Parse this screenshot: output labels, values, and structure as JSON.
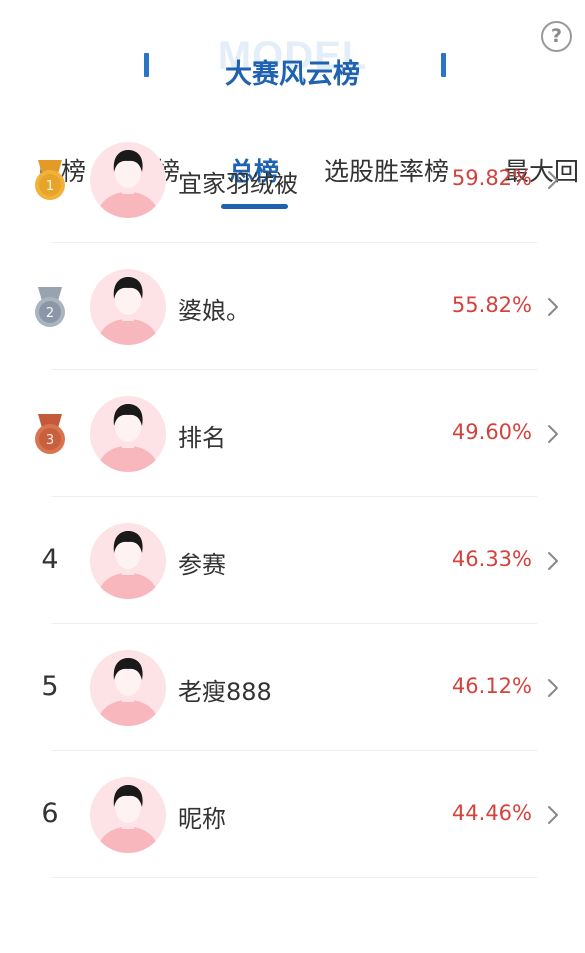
{
  "header": {
    "watermark": "MODEL",
    "title": "大赛风云榜",
    "help_icon": "question-circle-icon",
    "help_symbol": "?"
  },
  "tabs": [
    {
      "label": "日榜",
      "active": false
    },
    {
      "label": "周榜",
      "active": false
    },
    {
      "label": "总榜",
      "active": true
    },
    {
      "label": "选股胜率榜",
      "active": false
    },
    {
      "label": "最大回",
      "active": false
    }
  ],
  "colors": {
    "accent": "#1e62b0",
    "percent": "#d4423c",
    "gold": "#e7a42a",
    "silver": "#8b97a6",
    "bronze": "#c7603f",
    "avatar_bg": "#fde3e5"
  },
  "ranking": [
    {
      "rank": "1",
      "medal": "gold",
      "name": "宜家羽绒被",
      "value": "59.82%"
    },
    {
      "rank": "2",
      "medal": "silver",
      "name": "婆娘。",
      "value": "55.82%"
    },
    {
      "rank": "3",
      "medal": "bronze",
      "name": "排名",
      "value": "49.60%"
    },
    {
      "rank": "4",
      "medal": null,
      "name": "参赛",
      "value": "46.33%"
    },
    {
      "rank": "5",
      "medal": null,
      "name": "老瘦888",
      "value": "46.12%"
    },
    {
      "rank": "6",
      "medal": null,
      "name": "昵称",
      "value": "44.46%"
    }
  ]
}
